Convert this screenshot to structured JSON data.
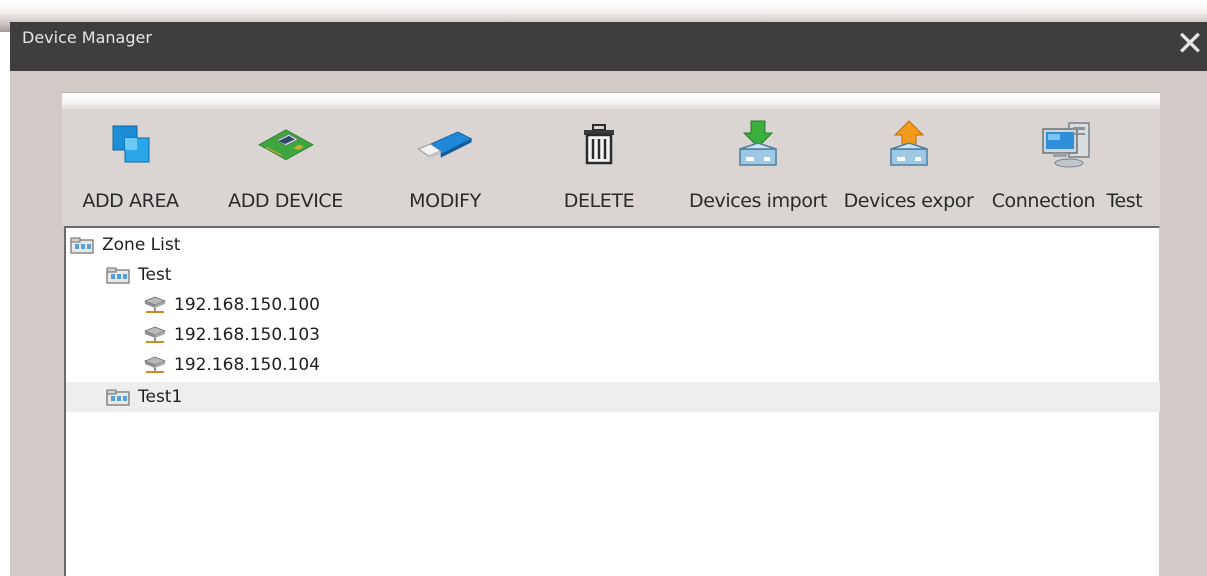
{
  "window": {
    "title": "Device Manager",
    "close_glyph": "✕"
  },
  "toolbar": {
    "items": [
      {
        "label": "ADD AREA",
        "icon": "add-area-icon"
      },
      {
        "label": "ADD DEVICE",
        "icon": "add-device-icon"
      },
      {
        "label": "MODIFY",
        "icon": "modify-icon"
      },
      {
        "label": "DELETE",
        "icon": "trash-icon"
      },
      {
        "label": "Devices import",
        "icon": "import-icon"
      },
      {
        "label": "Devices expor",
        "icon": "export-icon"
      },
      {
        "label": "Connection  Test",
        "icon": "computer-icon"
      }
    ]
  },
  "tree": {
    "root": {
      "label": "Zone List",
      "icon": "folder-icon"
    },
    "zones": [
      {
        "label": "Test",
        "icon": "folder-icon",
        "devices": [
          {
            "label": "192.168.150.100",
            "icon": "network-device-icon"
          },
          {
            "label": "192.168.150.103",
            "icon": "network-device-icon"
          },
          {
            "label": "192.168.150.104",
            "icon": "network-device-icon"
          }
        ]
      },
      {
        "label": "Test1",
        "icon": "folder-icon",
        "selected": true,
        "devices": []
      }
    ]
  },
  "colors": {
    "titlebar": "#3f3d3d",
    "frame": "#d2cac7",
    "toolbar": "#dad5d3",
    "selection": "#efeeee"
  }
}
